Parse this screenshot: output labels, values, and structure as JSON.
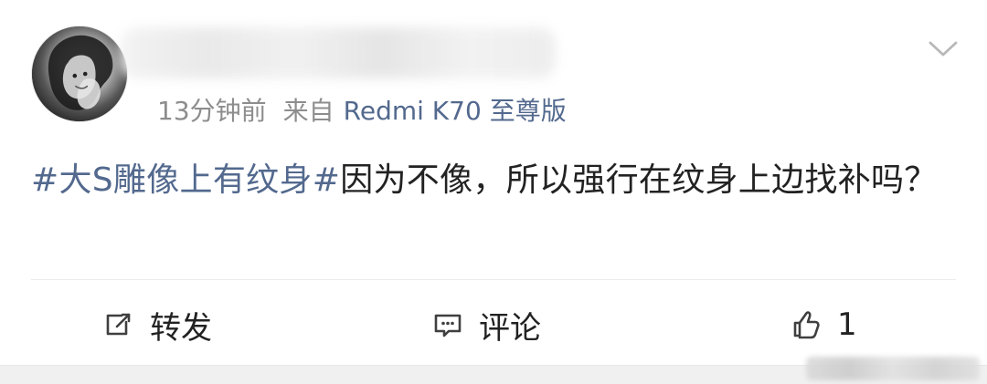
{
  "post": {
    "time": "13分钟前",
    "source_prefix": "来自",
    "device": "Redmi K70 至尊版",
    "hashtag": "#大S雕像上有纹身#",
    "text": "因为不像，所以强行在纹身上边找补吗？"
  },
  "actions": {
    "repost_label": "转发",
    "comment_label": "评论",
    "like_count": "1"
  },
  "icons": {
    "avatar": "avatar",
    "more": "chevron-down-icon",
    "repost": "repost-icon",
    "comment": "comment-icon",
    "like": "thumbs-up-icon"
  },
  "colors": {
    "hashtag": "#53698e",
    "meta": "#8d8d8d",
    "device": "#53698e",
    "text": "#222222",
    "divider": "#ececec"
  }
}
